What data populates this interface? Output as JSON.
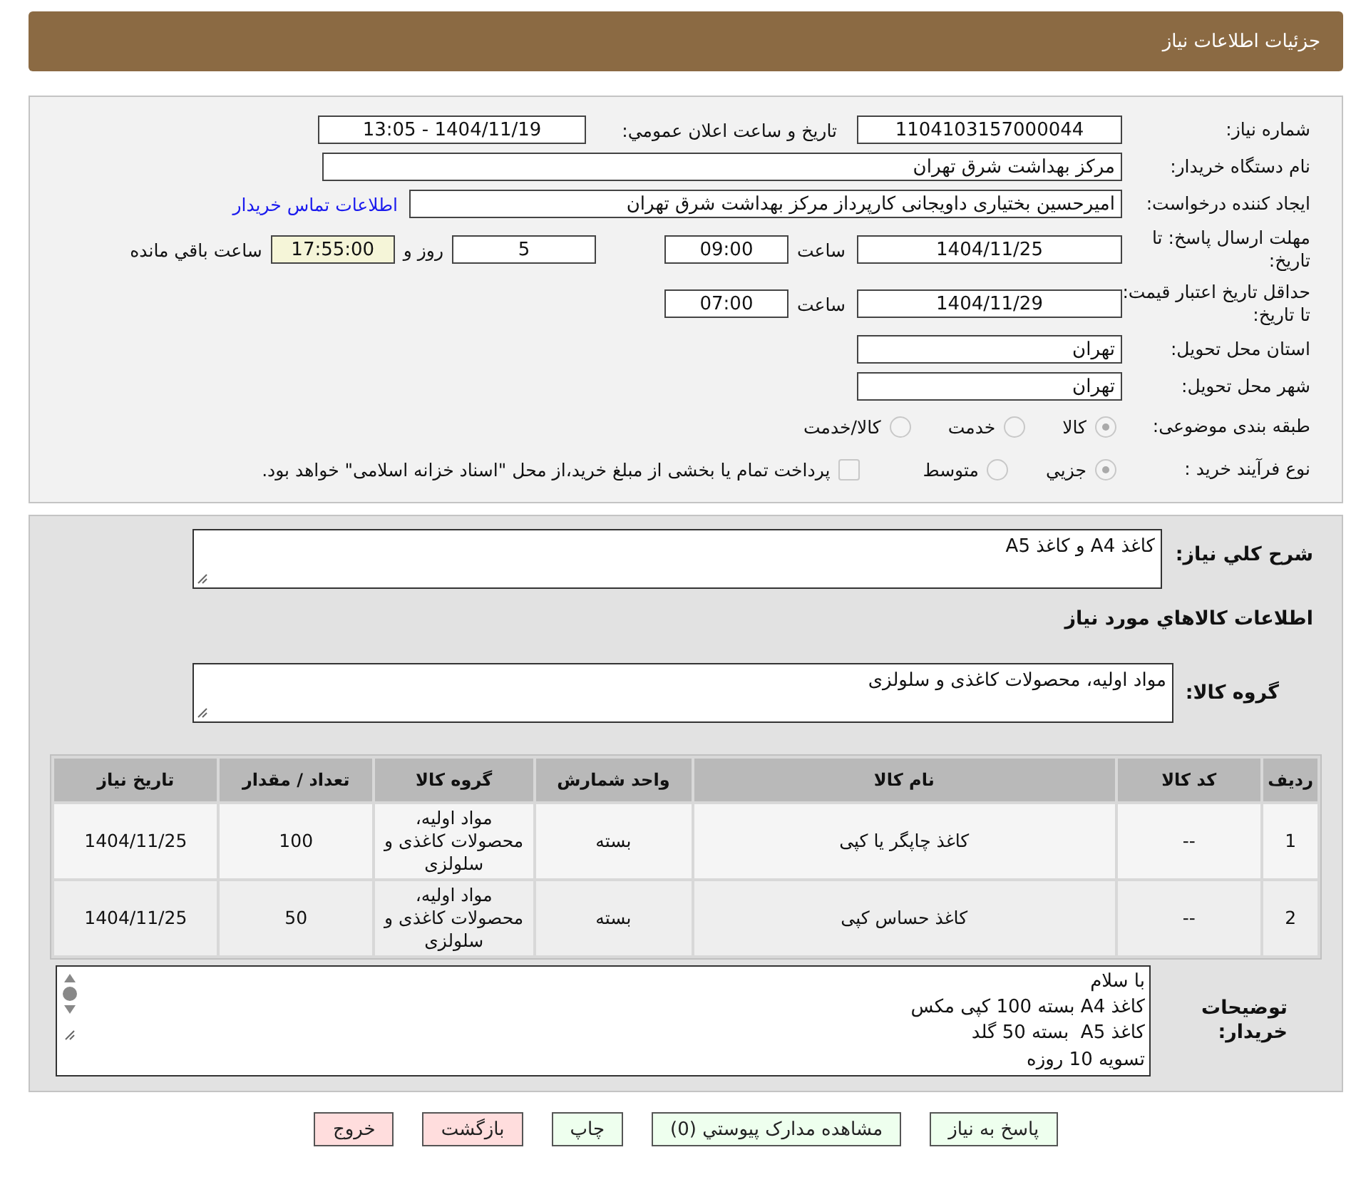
{
  "header": {
    "title": "جزئیات اطلاعات نیاز"
  },
  "details": {
    "need_number": {
      "label": "شماره نیاز:",
      "value": "1104103157000044"
    },
    "announce": {
      "label": "تاريخ و ساعت اعلان عمومي:",
      "value": "1404/11/19 - 13:05"
    },
    "buyer": {
      "label": "نام دستگاه خریدار:",
      "value": "مرکز بهداشت شرق تهران"
    },
    "requester": {
      "label": "ایجاد کننده درخواست:",
      "value": "امیرحسین بختیاری داویجانی کارپرداز مرکز بهداشت شرق تهران",
      "link": "اطلاعات تماس خریدار"
    },
    "deadline": {
      "label": "مهلت ارسال پاسخ: تا تاریخ:",
      "date": "1404/11/25",
      "time_label": "ساعت",
      "time": "09:00",
      "days": "5",
      "days_label": "روز و",
      "remaining": "17:55:00",
      "remaining_label": "ساعت باقي مانده"
    },
    "validity": {
      "label": "حداقل تاریخ اعتبار قیمت: تا تاریخ:",
      "date": "1404/11/29",
      "time_label": "ساعت",
      "time": "07:00"
    },
    "province": {
      "label": "استان محل تحویل:",
      "value": "تهران"
    },
    "city": {
      "label": "شهر محل تحویل:",
      "value": "تهران"
    },
    "category": {
      "label": "طبقه بندی موضوعی:",
      "options": [
        {
          "label": "کالا",
          "selected": true
        },
        {
          "label": "خدمت",
          "selected": false
        },
        {
          "label": "کالا/خدمت",
          "selected": false
        }
      ]
    },
    "process": {
      "label": "نوع فرآیند خرید :",
      "options": [
        {
          "label": "جزيي",
          "selected": true
        },
        {
          "label": "متوسط",
          "selected": false
        }
      ],
      "payment": {
        "label": "پرداخت تمام یا بخشی از مبلغ خرید،از محل \"اسناد خزانه اسلامی\" خواهد بود.",
        "checked": false
      }
    }
  },
  "description": {
    "label": "شرح کلي نیاز:",
    "value": "کاغذ A4 و کاغذ A5"
  },
  "goods_heading": "اطلاعات کالاهاي مورد نیاز",
  "goods_group": {
    "label": "گروه کالا:",
    "value": "مواد اولیه، محصولات کاغذی و سلولزی"
  },
  "table": {
    "columns": [
      "ردیف",
      "کد کالا",
      "نام کالا",
      "واحد شمارش",
      "گروه کالا",
      "تعداد / مقدار",
      "تاریخ نیاز"
    ],
    "rows": [
      [
        "1",
        "--",
        "کاغذ چاپگر یا کپی",
        "بسته",
        "مواد اولیه، محصولات کاغذی و سلولزی",
        "100",
        "1404/11/25"
      ],
      [
        "2",
        "--",
        "کاغذ حساس کپی",
        "بسته",
        "مواد اولیه، محصولات کاغذی و سلولزی",
        "50",
        "1404/11/25"
      ]
    ]
  },
  "notes": {
    "label": "توضیحات خریدار:",
    "lines": [
      "با سلام",
      "کاغذ A4 بسته 100 کپی مکس",
      "کاغذ A5  بسته 50 گلد",
      "تسویه 10 روزه"
    ]
  },
  "buttons": [
    {
      "label": "پاسخ به نیاز",
      "color": "#eeffee"
    },
    {
      "label": "مشاهده مدارک پیوستي (0)",
      "color": "#eeffee"
    },
    {
      "label": "چاپ",
      "color": "#eeffee"
    },
    {
      "label": "بازگشت",
      "color": "#ffdddd"
    },
    {
      "label": "خروج",
      "color": "#ffdddd"
    }
  ]
}
